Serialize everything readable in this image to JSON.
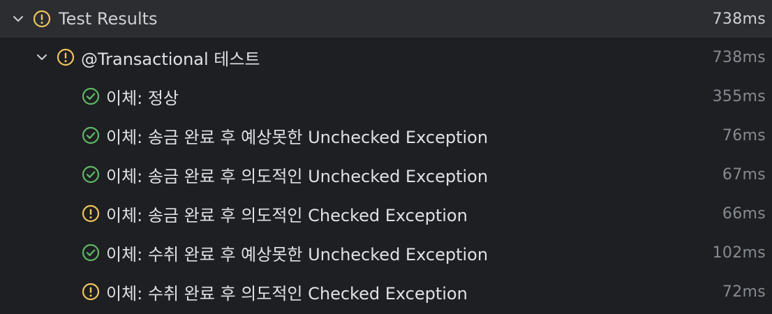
{
  "tree": {
    "root": {
      "label": "Test Results",
      "time": "738ms",
      "status": "warning",
      "expanded": true
    },
    "suite": {
      "label": "@Transactional 테스트",
      "time": "738ms",
      "status": "warning",
      "expanded": true
    },
    "tests": [
      {
        "label": "이체: 정상",
        "time": "355ms",
        "status": "passed"
      },
      {
        "label": "이체: 송금 완료 후 예상못한 Unchecked Exception",
        "time": "76ms",
        "status": "passed"
      },
      {
        "label": "이체: 송금 완료 후 의도적인 Unchecked Exception",
        "time": "67ms",
        "status": "passed"
      },
      {
        "label": "이체: 송금 완료 후 의도적인 Checked Exception",
        "time": "66ms",
        "status": "warning"
      },
      {
        "label": "이체: 수취 완료 후 예상못한 Unchecked Exception",
        "time": "102ms",
        "status": "passed"
      },
      {
        "label": "이체: 수취 완료 후 의도적인 Checked Exception",
        "time": "72ms",
        "status": "warning"
      }
    ]
  },
  "colors": {
    "background": "#1e1f22",
    "header_background": "#2b2d30",
    "passed": "#5fb865",
    "warning": "#f2c55c",
    "text": "#dfe1e5",
    "time": "#868a91"
  },
  "icons": {
    "chevron": "chevron-down-icon",
    "passed": "check-circle-icon",
    "warning": "warning-circle-icon"
  }
}
